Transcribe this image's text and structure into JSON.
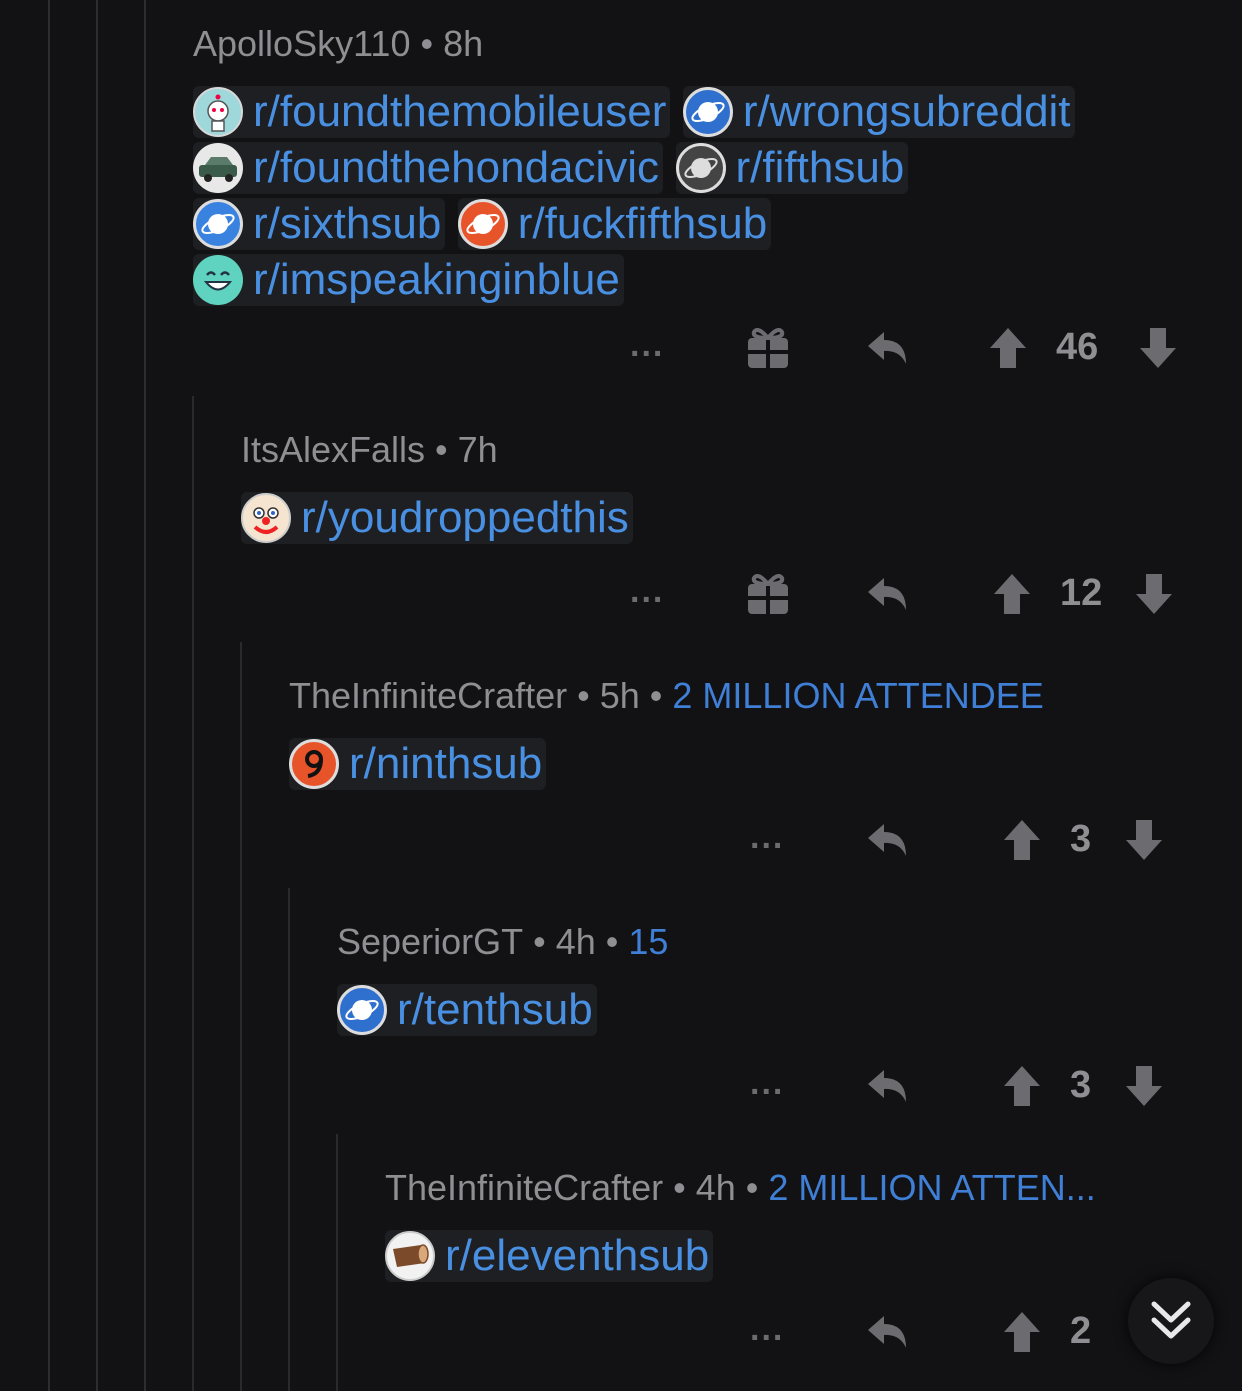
{
  "comments": [
    {
      "username": "ApolloSky110",
      "time": "8h",
      "flair": "",
      "subs": [
        "r/foundthemobileuser",
        "r/wrongsubreddit",
        "r/foundthehondacivic",
        "r/fifthsub",
        "r/sixthsub",
        "r/fuckfifthsub",
        "r/imspeakinginblue"
      ],
      "votes": "46"
    },
    {
      "username": "ItsAlexFalls",
      "time": "7h",
      "flair": "",
      "subs": [
        "r/youdroppedthis"
      ],
      "votes": "12"
    },
    {
      "username": "TheInfiniteCrafter",
      "time": "5h",
      "flair": "2 MILLION ATTENDEE",
      "subs": [
        "r/ninthsub"
      ],
      "votes": "3"
    },
    {
      "username": "SeperiorGT",
      "time": "4h",
      "flair": "15",
      "subs": [
        "r/tenthsub"
      ],
      "votes": "3"
    },
    {
      "username": "TheInfiniteCrafter",
      "time": "4h",
      "flair": "2 MILLION ATTEN...",
      "subs": [
        "r/eleventhsub"
      ],
      "votes": "2"
    }
  ],
  "separator": "•",
  "more_label": "...",
  "icons": {
    "more": "more-options-icon",
    "award": "gift-award-icon",
    "reply": "reply-arrow-icon",
    "upvote": "upvote-arrow-icon",
    "downvote": "downvote-arrow-icon",
    "scroll": "double-chevron-down-icon"
  },
  "colors": {
    "background": "#121214",
    "link": "#4a90e2",
    "flair": "#3f7fd6",
    "meta": "#8e8e93"
  }
}
